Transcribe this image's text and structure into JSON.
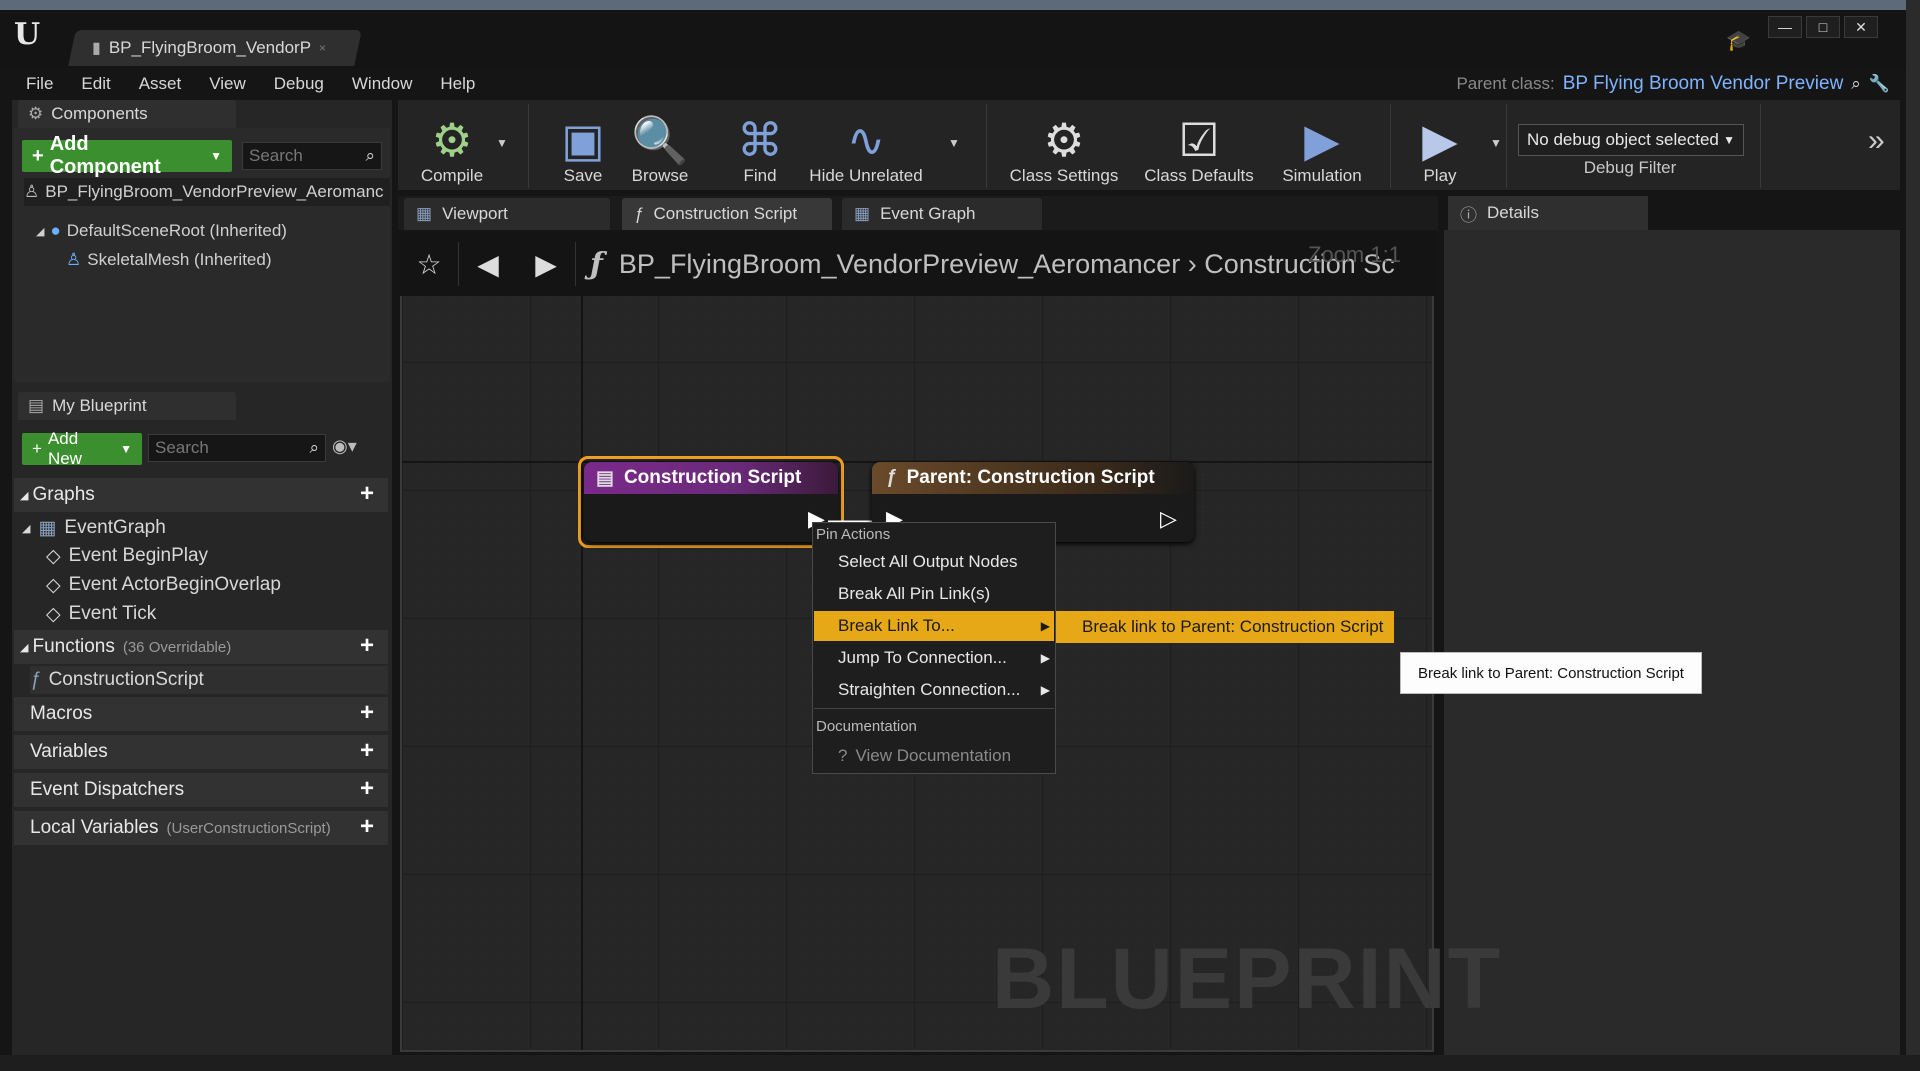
{
  "window": {
    "doc_tab": "BP_FlyingBroom_VendorP",
    "tab_close": "×",
    "buttons": [
      "—",
      "□",
      "✕"
    ]
  },
  "menu": [
    "File",
    "Edit",
    "Asset",
    "View",
    "Debug",
    "Window",
    "Help"
  ],
  "parent_class": {
    "label": "Parent class:",
    "value": "BP Flying Broom Vendor Preview"
  },
  "components": {
    "tab": "Components",
    "add_button": "Add Component",
    "search_placeholder": "Search",
    "blueprint": "BP_FlyingBroom_VendorPreview_Aeromanc",
    "root": "DefaultSceneRoot (Inherited)",
    "mesh": "SkeletalMesh (Inherited)"
  },
  "my_blueprint": {
    "tab": "My Blueprint",
    "add_button": "Add New",
    "search_placeholder": "Search",
    "graphs": "Graphs",
    "event_graph": "EventGraph",
    "events": [
      "Event BeginPlay",
      "Event ActorBeginOverlap",
      "Event Tick"
    ],
    "functions": "Functions",
    "functions_sub": "(36 Overridable)",
    "construction_script": "ConstructionScript",
    "macros": "Macros",
    "variables": "Variables",
    "dispatchers": "Event Dispatchers",
    "local_vars": "Local Variables",
    "local_vars_sub": "(UserConstructionScript)"
  },
  "toolbar": {
    "compile": "Compile",
    "save": "Save",
    "browse": "Browse",
    "find": "Find",
    "hide_unrelated": "Hide Unrelated",
    "class_settings": "Class Settings",
    "class_defaults": "Class Defaults",
    "simulation": "Simulation",
    "play": "Play",
    "debug_select": "No debug object selected",
    "debug_filter": "Debug Filter"
  },
  "graph_tabs": [
    "Viewport",
    "Construction Script",
    "Event Graph"
  ],
  "details_tab": "Details",
  "breadcrumb": {
    "path": "BP_FlyingBroom_VendorPreview_Aeromancer",
    "current": "Construction Sc",
    "zoom": "Zoom 1:1"
  },
  "nodes": {
    "node1": "Construction Script",
    "node2": "Parent: Construction Script"
  },
  "context_menu": {
    "header1": "Pin Actions",
    "items": [
      "Select All Output Nodes",
      "Break All Pin Link(s)",
      "Break Link To...",
      "Jump To Connection...",
      "Straighten Connection..."
    ],
    "header2": "Documentation",
    "doc_item": "View Documentation"
  },
  "submenu": "Break link to Parent: Construction Script",
  "tooltip": "Break link to Parent: Construction Script",
  "watermark": "BLUEPRINT"
}
